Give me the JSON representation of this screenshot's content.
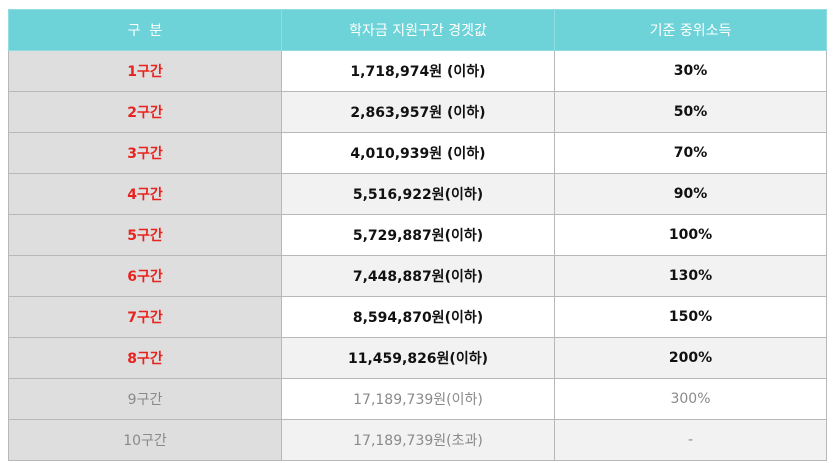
{
  "header": {
    "col1": "구  분",
    "col2": "학자금 지원구간 경곗값",
    "col3": "기준 중위소득"
  },
  "rows": [
    {
      "tier": "1구간",
      "threshold": "1,718,974원 (이하)",
      "income": "30%"
    },
    {
      "tier": "2구간",
      "threshold": "2,863,957원 (이하)",
      "income": "50%"
    },
    {
      "tier": "3구간",
      "threshold": "4,010,939원 (이하)",
      "income": "70%"
    },
    {
      "tier": "4구간",
      "threshold": "5,516,922원(이하)",
      "income": "90%"
    },
    {
      "tier": "5구간",
      "threshold": "5,729,887원(이하)",
      "income": "100%"
    },
    {
      "tier": "6구간",
      "threshold": "7,448,887원(이하)",
      "income": "130%"
    },
    {
      "tier": "7구간",
      "threshold": "8,594,870원(이하)",
      "income": "150%"
    },
    {
      "tier": "8구간",
      "threshold": "11,459,826원(이하)",
      "income": "200%"
    },
    {
      "tier": "9구간",
      "threshold": "17,189,739원(이하)",
      "income": "300%"
    },
    {
      "tier": "10구간",
      "threshold": "17,189,739원(초과)",
      "income": "-"
    }
  ],
  "colors": {
    "header_bg": "#6dd3d8",
    "tier_text": "#e8231f",
    "muted_text": "#8a8a8a",
    "tier_cell_bg": "#dedede"
  }
}
